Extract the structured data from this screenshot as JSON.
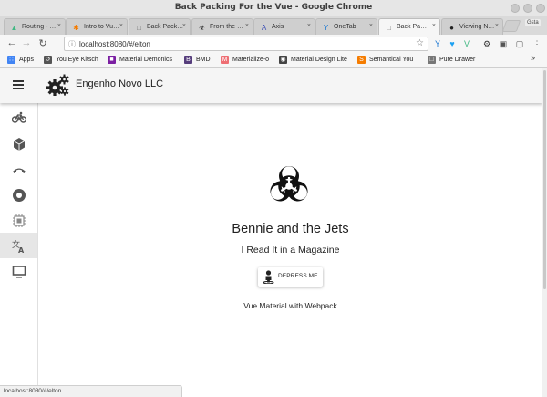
{
  "window": {
    "title": "Back Packing For the Vue - Google Chrome"
  },
  "tabs": [
    {
      "label": "Routing - …",
      "icon": "vue-icon",
      "glyph": "▲",
      "color": "#41b883",
      "active": false
    },
    {
      "label": "Intro to Vu…",
      "icon": "asterisk-icon",
      "glyph": "✱",
      "color": "#f57c00",
      "active": false
    },
    {
      "label": "Back Pack…",
      "icon": "page-icon",
      "glyph": "□",
      "color": "#666666",
      "active": false
    },
    {
      "label": "From the …",
      "icon": "biohazard-icon",
      "glyph": "☣",
      "color": "#222222",
      "active": false
    },
    {
      "label": "Axis",
      "icon": "axis-icon",
      "glyph": "A",
      "color": "#3f51b5",
      "active": false
    },
    {
      "label": "OneTab",
      "icon": "onetab-icon",
      "glyph": "Y",
      "color": "#1976d2",
      "active": false
    },
    {
      "label": "Back Pa…",
      "icon": "page-icon",
      "glyph": "□",
      "color": "#666666",
      "active": true
    },
    {
      "label": "Viewing N…",
      "icon": "github-icon",
      "glyph": "●",
      "color": "#222222",
      "active": false
    }
  ],
  "toolbar": {
    "back": "←",
    "forward": "→",
    "reload": "↻",
    "info": "ⓘ",
    "url": "localhost:8080/#/elton",
    "star": "☆",
    "guest": "Gsta"
  },
  "extensions": [
    {
      "icon": "vue-devtools-icon",
      "glyph": "Y",
      "color": "#1976d2"
    },
    {
      "icon": "twitter-icon",
      "glyph": "♥",
      "color": "#1da1f2"
    },
    {
      "icon": "vue-icon",
      "glyph": "V",
      "color": "#41b883"
    },
    {
      "icon": "gear-icon",
      "glyph": "⚙",
      "color": "#333333"
    },
    {
      "icon": "extension-icon",
      "glyph": "▣",
      "color": "#555555"
    },
    {
      "icon": "cast-icon",
      "glyph": "▢",
      "color": "#555555"
    },
    {
      "icon": "menu-icon",
      "glyph": "⋮",
      "color": "#555555"
    }
  ],
  "bookmarks": [
    {
      "label": "Apps",
      "icon": "apps-icon",
      "glyph": "∷",
      "color": "#4285f4"
    },
    {
      "label": "You Eye Kitsch",
      "icon": "loop-icon",
      "glyph": "↺",
      "color": "#555555"
    },
    {
      "label": "Material Demonics",
      "icon": "material-icon",
      "glyph": "■",
      "color": "#7b1fa2"
    },
    {
      "label": "BMD",
      "icon": "bootstrap-icon",
      "glyph": "B",
      "color": "#563d7c"
    },
    {
      "label": "Materialize-o",
      "icon": "materialize-icon",
      "glyph": "M",
      "color": "#ee6e73"
    },
    {
      "label": "Material Design Lite",
      "icon": "mdl-icon",
      "glyph": "◉",
      "color": "#444444"
    },
    {
      "label": "Semantical You",
      "icon": "semantic-icon",
      "glyph": "S",
      "color": "#f57c00"
    },
    {
      "label": "Pure Drawer",
      "icon": "page-icon",
      "glyph": "□",
      "color": "#777777"
    }
  ],
  "bookmarks_more": "»",
  "app": {
    "title": "Engenho Novo LLC"
  },
  "sidenav": [
    {
      "icon": "bike-icon",
      "active": false
    },
    {
      "icon": "box-icon",
      "active": false
    },
    {
      "icon": "phone-hangup-icon",
      "active": false
    },
    {
      "icon": "record-icon",
      "active": false
    },
    {
      "icon": "chip-icon",
      "active": false
    },
    {
      "icon": "translate-icon",
      "active": true
    },
    {
      "icon": "monitor-icon",
      "active": false
    }
  ],
  "main": {
    "heading": "Bennie and the Jets",
    "subheading": "I Read It in a Magazine",
    "button_label": "DEPRESS ME",
    "footer": "Vue Material with Webpack"
  },
  "status": {
    "text": "localhost:8080/#/elton"
  }
}
